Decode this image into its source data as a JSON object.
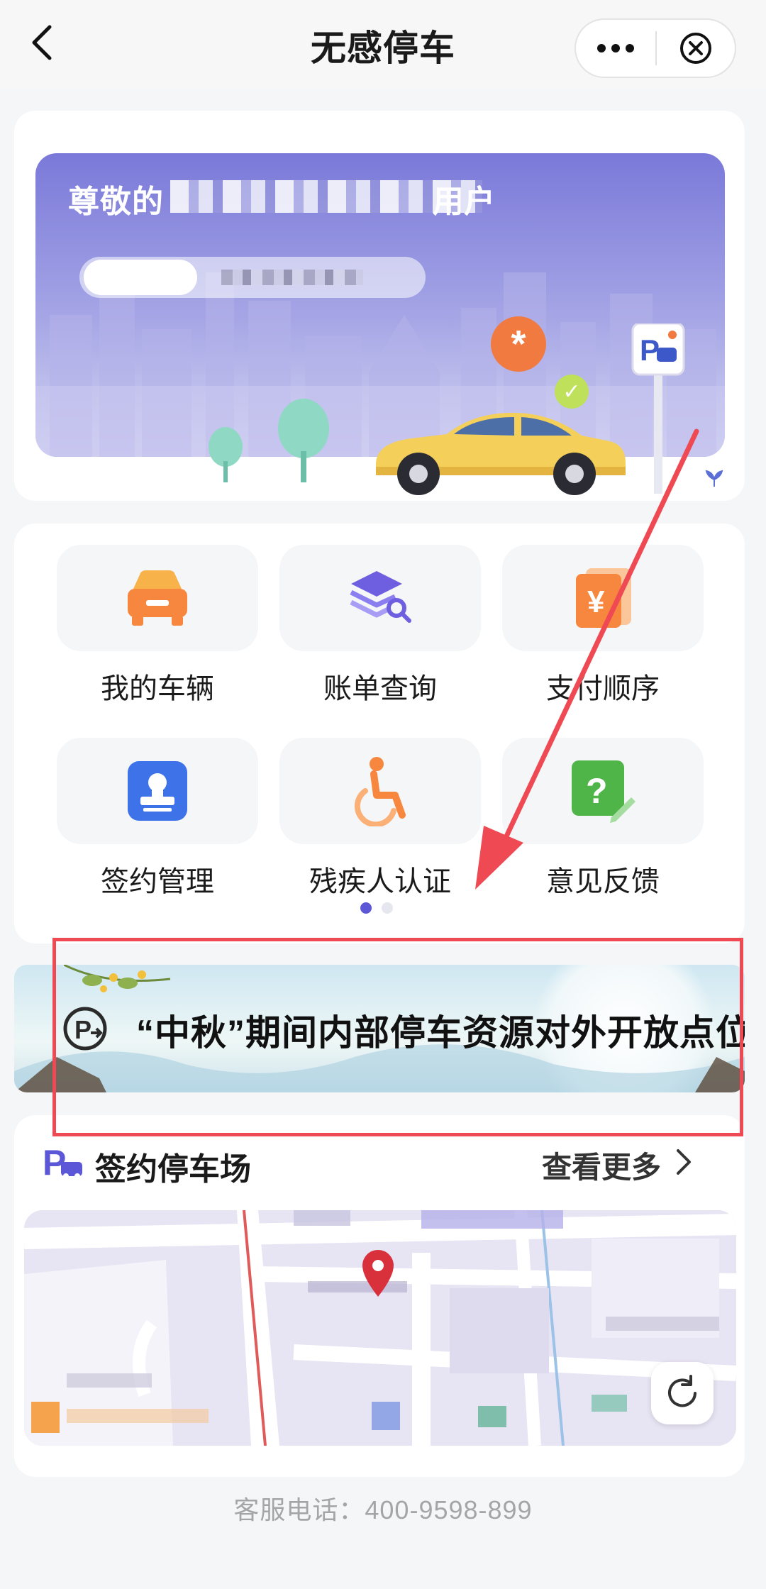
{
  "header": {
    "title": "无感停车"
  },
  "hero": {
    "greeting": "尊敬的",
    "greeting_suffix": "用户",
    "badge_star": "*",
    "badge_check": "✓"
  },
  "grid": {
    "items": [
      {
        "label": "我的车辆",
        "icon": "car-icon"
      },
      {
        "label": "账单查询",
        "icon": "bill-search-icon"
      },
      {
        "label": "支付顺序",
        "icon": "payment-order-icon"
      },
      {
        "label": "签约管理",
        "icon": "contract-stamp-icon"
      },
      {
        "label": "残疾人认证",
        "icon": "wheelchair-icon"
      },
      {
        "label": "意见反馈",
        "icon": "feedback-icon"
      }
    ],
    "page_indicator": {
      "current": 1,
      "total": 2
    }
  },
  "promo": {
    "text": "“中秋”期间内部停车资源对外开放点位"
  },
  "parking": {
    "title": "签约停车场",
    "more_label": "查看更多"
  },
  "footer": {
    "phone_text": "客服电话：400-9598-899"
  },
  "colors": {
    "accent": "#5b57d6",
    "annotation_red": "#ef4a53",
    "map_pin": "#d9313b"
  }
}
